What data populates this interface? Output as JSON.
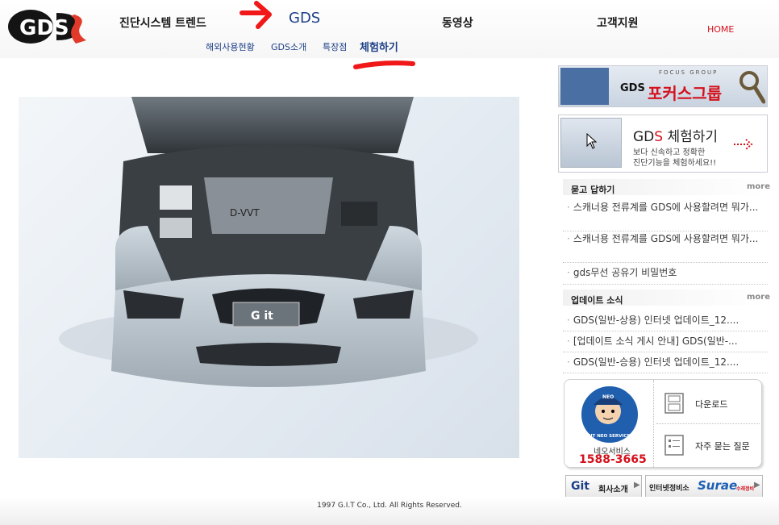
{
  "logo": {
    "text": "GDS"
  },
  "nav": {
    "items": [
      {
        "label": "진단시스템 트렌드"
      },
      {
        "label": "GDS"
      },
      {
        "label": "동영상"
      },
      {
        "label": "고객지원"
      }
    ],
    "home_label": "HOME",
    "sub_items": [
      {
        "label": "해외사용현황"
      },
      {
        "label": "GDS소개"
      },
      {
        "label": "특장점"
      },
      {
        "label": "체험하기"
      }
    ]
  },
  "hero": {
    "plate_text": "G it"
  },
  "sidebar": {
    "focus_banner": {
      "caption": "FOCUS GROUP",
      "logo": "GDS",
      "title": "포커스그룹"
    },
    "trial_banner": {
      "title_prefix": "GD",
      "title_accent": "S",
      "title_suffix": " 체험하기",
      "desc_line1": "보다 신속하고 정확한",
      "desc_line2": "진단기능을 체험하세요!!"
    },
    "qa": {
      "title": "묻고 답하기",
      "more": "more",
      "items": [
        {
          "text": "스캐너용 전류계를 GDS에 사용할려면 뭐가..."
        },
        {
          "text": "스캐너용 전류계를 GDS에 사용할려면 뭐가..."
        },
        {
          "text": "gds무선 공유기 비밀번호"
        }
      ]
    },
    "updates": {
      "title": "업데이트 소식",
      "more": "more",
      "items": [
        {
          "text": "GDS(일반-상용) 인터넷 업데이트_12...."
        },
        {
          "text": "[업데이트 소식 게시 안내] GDS(일반-..."
        },
        {
          "text": "GDS(일반-승용) 인터넷 업데이트_12...."
        }
      ]
    },
    "service": {
      "mascot_badge": "NEO",
      "ring_text": "GIT NEO SERVICE",
      "name": "네오서비스",
      "phone": "1588-3665",
      "download": "다운로드",
      "faq": "자주 묻는 질문"
    },
    "company_btn": {
      "logo": "Git",
      "label": "회사소개"
    },
    "repair_btn": {
      "label": "인터넷정비소",
      "brand": "Surae",
      "brand_sub": "수래정비"
    }
  },
  "footer": {
    "copyright": "1997 G.I.T Co., Ltd. All Rights Reserved."
  },
  "colors": {
    "brand_red": "#d4111c",
    "nav_blue": "#1d3f87"
  }
}
